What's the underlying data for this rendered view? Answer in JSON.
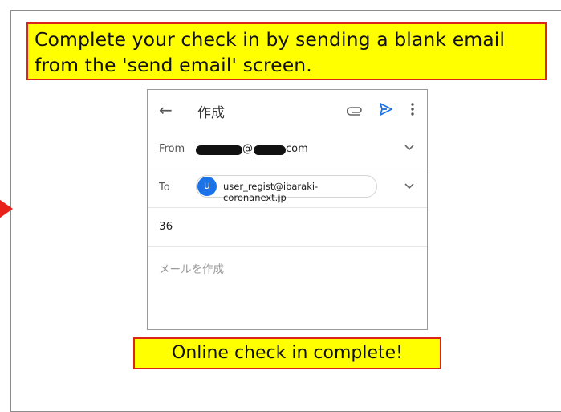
{
  "instruction": "Complete your check in by sending a blank email from the 'send email' screen.",
  "completion": "Online check in complete!",
  "email": {
    "title": "作成",
    "from_label": "From",
    "from_domain_suffix": "com",
    "from_at": "@",
    "to_label": "To",
    "to_avatar_letter": "u",
    "to_address": "user_regist@ibaraki-coronanext.jp",
    "subject": "36",
    "body_placeholder": "メールを作成"
  },
  "colors": {
    "callout_bg": "#ffff00",
    "callout_border": "#d9261c",
    "arrow": "#e8211b",
    "send_icon": "#1a73e8"
  }
}
